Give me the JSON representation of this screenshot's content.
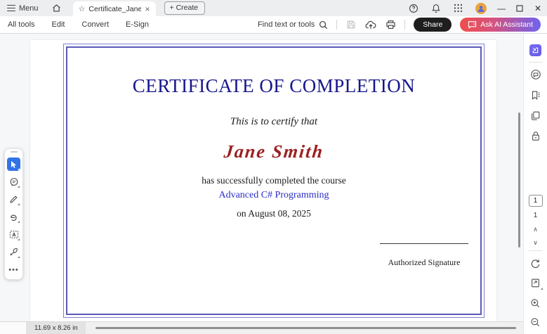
{
  "titlebar": {
    "menu_label": "Menu",
    "tab_title": "Certificate_Jane_Smith...",
    "create_label": "+ Create"
  },
  "toolbar": {
    "items": [
      {
        "label": "All tools"
      },
      {
        "label": "Edit"
      },
      {
        "label": "Convert"
      },
      {
        "label": "E-Sign"
      }
    ],
    "find_label": "Find text or tools",
    "share_label": "Share",
    "ask_ai_label": "Ask AI Assistant"
  },
  "certificate": {
    "title": "CERTIFICATE OF COMPLETION",
    "subtitle": "This is to certify that",
    "name": "Jane Smith",
    "completion_line": "has successfully completed the course",
    "course": "Advanced C# Programming",
    "date_line": "on August 08, 2025",
    "signature_label": "Authorized Signature"
  },
  "page_nav": {
    "current_page": "1",
    "total_pages": "1",
    "chevron_up": "∧",
    "chevron_down": "∨"
  },
  "statusbar": {
    "dimensions": "11.69 x 8.26 in"
  },
  "colors": {
    "cert_border": "#5a5ab8",
    "cert_title": "#16168c",
    "cert_name": "#9c1f1f",
    "cert_course": "#2c2cc8",
    "askai_gradient_start": "#ef4e4b",
    "askai_gradient_end": "#6f63ef",
    "active_tool": "#3273e8"
  }
}
